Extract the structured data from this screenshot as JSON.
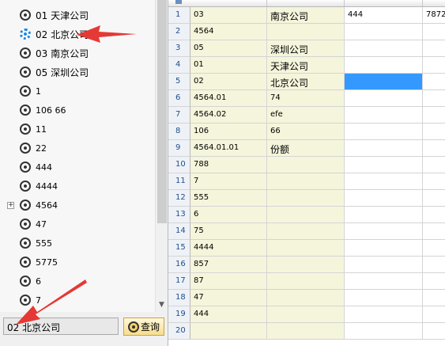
{
  "tree": {
    "nodes": [
      {
        "label": "01 天津公司",
        "icon": "radio-node-icon",
        "cn": true
      },
      {
        "label": "02 北京公司",
        "icon": "gear-node-icon",
        "cn": true,
        "selected": true
      },
      {
        "label": "03 南京公司",
        "icon": "radio-node-icon",
        "cn": true
      },
      {
        "label": "05 深圳公司",
        "icon": "radio-node-icon",
        "cn": true
      },
      {
        "label": "1",
        "icon": "radio-node-icon"
      },
      {
        "label": "106 66",
        "icon": "radio-node-icon"
      },
      {
        "label": "11",
        "icon": "radio-node-icon"
      },
      {
        "label": "22",
        "icon": "radio-node-icon"
      },
      {
        "label": "444",
        "icon": "radio-node-icon"
      },
      {
        "label": "4444",
        "icon": "radio-node-icon"
      },
      {
        "label": "4564",
        "icon": "radio-node-icon",
        "expandable": true
      },
      {
        "label": "47",
        "icon": "radio-node-icon"
      },
      {
        "label": "555",
        "icon": "radio-node-icon"
      },
      {
        "label": "5775",
        "icon": "radio-node-icon"
      },
      {
        "label": "6",
        "icon": "radio-node-icon"
      },
      {
        "label": "7",
        "icon": "radio-node-icon"
      }
    ],
    "expander_symbol": "+",
    "scroll_down_symbol": "▼"
  },
  "search": {
    "value": "02 北京公司",
    "button_label": "查询"
  },
  "grid": {
    "rows": [
      {
        "num": "1",
        "code": "03",
        "name": "南京公司",
        "short": "444",
        "extra": "7872"
      },
      {
        "num": "2",
        "code": "4564",
        "name": "",
        "short": "",
        "extra": ""
      },
      {
        "num": "3",
        "code": "05",
        "name": "深圳公司",
        "short": "",
        "extra": ""
      },
      {
        "num": "4",
        "code": "01",
        "name": "天津公司",
        "short": "",
        "extra": ""
      },
      {
        "num": "5",
        "code": "02",
        "name": "北京公司",
        "short": "",
        "extra": "",
        "selected_short": true
      },
      {
        "num": "6",
        "code": "4564.01",
        "name": "74",
        "short": "",
        "extra": "",
        "latin": true
      },
      {
        "num": "7",
        "code": "4564.02",
        "name": "efe",
        "short": "",
        "extra": "",
        "latin": true
      },
      {
        "num": "8",
        "code": "106",
        "name": "66",
        "short": "",
        "extra": "",
        "latin": true
      },
      {
        "num": "9",
        "code": "4564.01.01",
        "name": "份额",
        "short": "",
        "extra": ""
      },
      {
        "num": "10",
        "code": "788",
        "name": "",
        "short": "",
        "extra": ""
      },
      {
        "num": "11",
        "code": "7",
        "name": "",
        "short": "",
        "extra": ""
      },
      {
        "num": "12",
        "code": "555",
        "name": "",
        "short": "",
        "extra": ""
      },
      {
        "num": "13",
        "code": "6",
        "name": "",
        "short": "",
        "extra": ""
      },
      {
        "num": "14",
        "code": "75",
        "name": "",
        "short": "",
        "extra": ""
      },
      {
        "num": "15",
        "code": "4444",
        "name": "",
        "short": "",
        "extra": ""
      },
      {
        "num": "16",
        "code": "857",
        "name": "",
        "short": "",
        "extra": ""
      },
      {
        "num": "17",
        "code": "87",
        "name": "",
        "short": "",
        "extra": ""
      },
      {
        "num": "18",
        "code": "47",
        "name": "",
        "short": "",
        "extra": ""
      },
      {
        "num": "19",
        "code": "444",
        "name": "",
        "short": "",
        "extra": ""
      },
      {
        "num": "20",
        "code": "",
        "name": "",
        "short": "",
        "extra": ""
      }
    ]
  },
  "colors": {
    "annotation_arrow": "#e53935",
    "selected_cell": "#3399ff",
    "key_column_bg": "#f5f5dc"
  }
}
